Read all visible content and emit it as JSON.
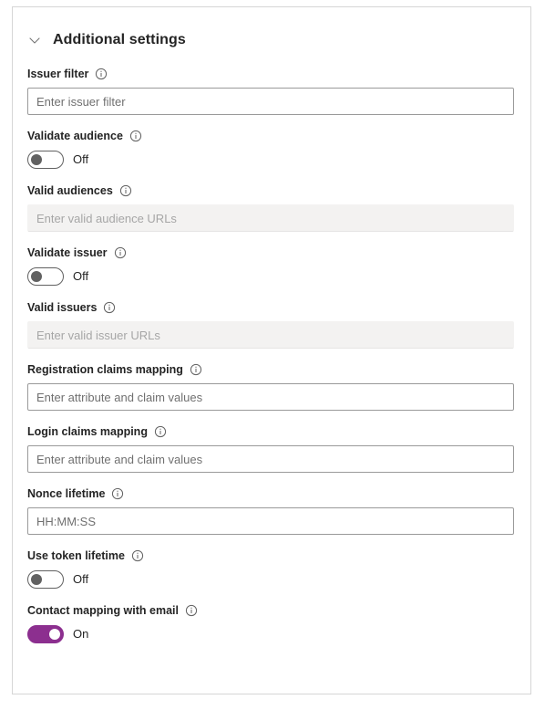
{
  "section": {
    "title": "Additional settings",
    "expanded": true,
    "chevron_icon": "chevron-down-icon"
  },
  "colors": {
    "toggle_on": "#8c2f8f",
    "toggle_off_border": "#616161",
    "panel_border": "#d6d6d6",
    "input_border": "#9a9a9a",
    "disabled_background": "#f3f2f1",
    "text": "#242424",
    "placeholder": "#707070"
  },
  "fields": {
    "issuer_filter": {
      "label": "Issuer filter",
      "info_icon": "info-icon",
      "placeholder": "Enter issuer filter",
      "value": "",
      "disabled": false
    },
    "validate_audience": {
      "label": "Validate audience",
      "info_icon": "info-icon",
      "state": "Off",
      "on": false
    },
    "valid_audiences": {
      "label": "Valid audiences",
      "info_icon": "info-icon",
      "placeholder": "Enter valid audience URLs",
      "value": "",
      "disabled": true
    },
    "validate_issuer": {
      "label": "Validate issuer",
      "info_icon": "info-icon",
      "state": "Off",
      "on": false
    },
    "valid_issuers": {
      "label": "Valid issuers",
      "info_icon": "info-icon",
      "placeholder": "Enter valid issuer URLs",
      "value": "",
      "disabled": true
    },
    "registration_claims_mapping": {
      "label": "Registration claims mapping",
      "info_icon": "info-icon",
      "placeholder": "Enter attribute and claim values",
      "value": "",
      "disabled": false
    },
    "login_claims_mapping": {
      "label": "Login claims mapping",
      "info_icon": "info-icon",
      "placeholder": "Enter attribute and claim values",
      "value": "",
      "disabled": false
    },
    "nonce_lifetime": {
      "label": "Nonce lifetime",
      "info_icon": "info-icon",
      "placeholder": "HH:MM:SS",
      "value": "",
      "disabled": false
    },
    "use_token_lifetime": {
      "label": "Use token lifetime",
      "info_icon": "info-icon",
      "state": "Off",
      "on": false
    },
    "contact_mapping_with_email": {
      "label": "Contact mapping with email",
      "info_icon": "info-icon",
      "state": "On",
      "on": true
    }
  }
}
